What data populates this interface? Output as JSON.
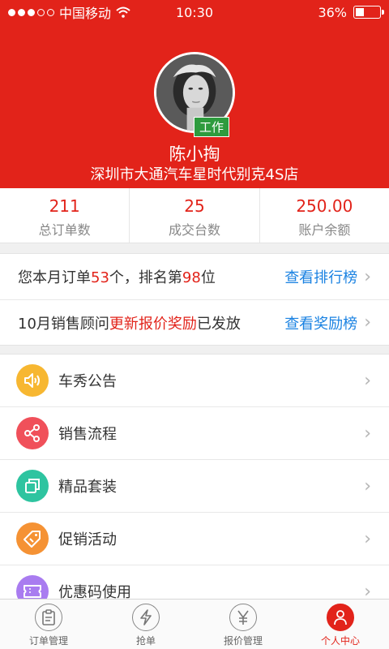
{
  "status_bar": {
    "carrier": "中国移动",
    "time": "10:30",
    "battery": "36%",
    "battery_level": 0.36
  },
  "profile": {
    "role_badge": "工作",
    "name": "陈小掏",
    "store": "深圳市大通汽车星时代别克4S店"
  },
  "stats": [
    {
      "value": "211",
      "label": "总订单数"
    },
    {
      "value": "25",
      "label": "成交台数"
    },
    {
      "value": "250.00",
      "label": "账户余额"
    }
  ],
  "notices": {
    "ranking": {
      "prefix": "您本月订单",
      "orders": "53",
      "middle": "个，排名第",
      "rank": "98",
      "suffix": "位",
      "link": "查看排行榜"
    },
    "reward": {
      "prefix": "10月销售顾问",
      "highlight": "更新报价奖励",
      "suffix": "已发放",
      "link": "查看奖励榜"
    }
  },
  "menu": [
    {
      "label": "车秀公告",
      "icon": "speaker-icon",
      "color": "#f7b731"
    },
    {
      "label": "销售流程",
      "icon": "share-icon",
      "color": "#f0505a"
    },
    {
      "label": "精品套装",
      "icon": "copy-icon",
      "color": "#2ec4a0"
    },
    {
      "label": "促销活动",
      "icon": "tag-icon",
      "color": "#f59234"
    },
    {
      "label": "优惠码使用",
      "icon": "ticket-icon",
      "color": "#a97cf0"
    }
  ],
  "tabs": [
    {
      "label": "订单管理",
      "icon": "clipboard-icon"
    },
    {
      "label": "抢单",
      "icon": "lightning-icon"
    },
    {
      "label": "报价管理",
      "icon": "yen-icon"
    },
    {
      "label": "个人中心",
      "icon": "person-icon",
      "active": true
    }
  ],
  "colors": {
    "brand": "#e2231a",
    "link": "#1a82e2",
    "badge": "#2e9b3e"
  }
}
